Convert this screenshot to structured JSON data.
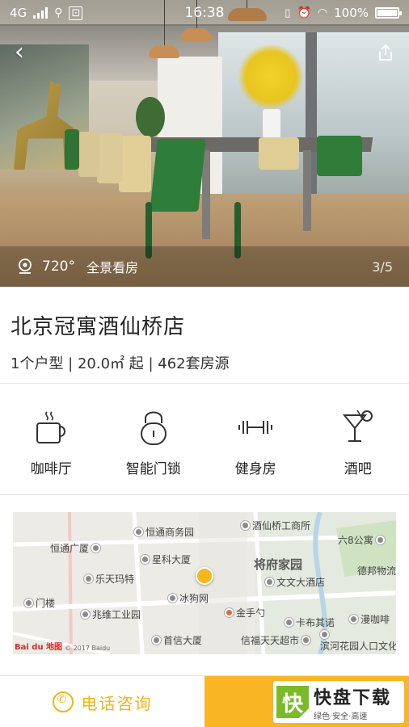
{
  "status_bar": {
    "network": "4G",
    "time": "16:38",
    "battery": "100%"
  },
  "hero": {
    "panorama_degree": "720°",
    "panorama_label": "全景看房",
    "pager": "3/5"
  },
  "listing": {
    "title": "北京冠寓酒仙桥店",
    "subtitle": "1个户型 | 20.0㎡ 起 | 462套房源"
  },
  "amenities": [
    {
      "label": "咖啡厅",
      "icon": "coffee-cup-icon"
    },
    {
      "label": "智能门锁",
      "icon": "padlock-icon"
    },
    {
      "label": "健身房",
      "icon": "dumbbell-icon"
    },
    {
      "label": "酒吧",
      "icon": "cocktail-icon"
    }
  ],
  "map": {
    "pois": [
      "恒通商务园",
      "酒仙桥工商所",
      "六8公寓",
      "恒通广厦",
      "星科大厦",
      "将府家园",
      "乐天玛特",
      "文文大酒店",
      "德邦物流",
      "门楼",
      "冰狗网",
      "兆维工业园",
      "金手勺",
      "卡布其诺",
      "漫咖啡",
      "首信大厦",
      "信福天天超市",
      "滨河花园人口文化广场"
    ],
    "logo": "Bai du 地图",
    "copyright": "© 2017 Baidu"
  },
  "bottom_bar": {
    "call_label": "电话咨询",
    "watermark_main": "快盘下载",
    "watermark_sub": "绿色·安全·高速"
  },
  "colors": {
    "accent": "#f0b516",
    "bottom_right": "#f9b524"
  }
}
